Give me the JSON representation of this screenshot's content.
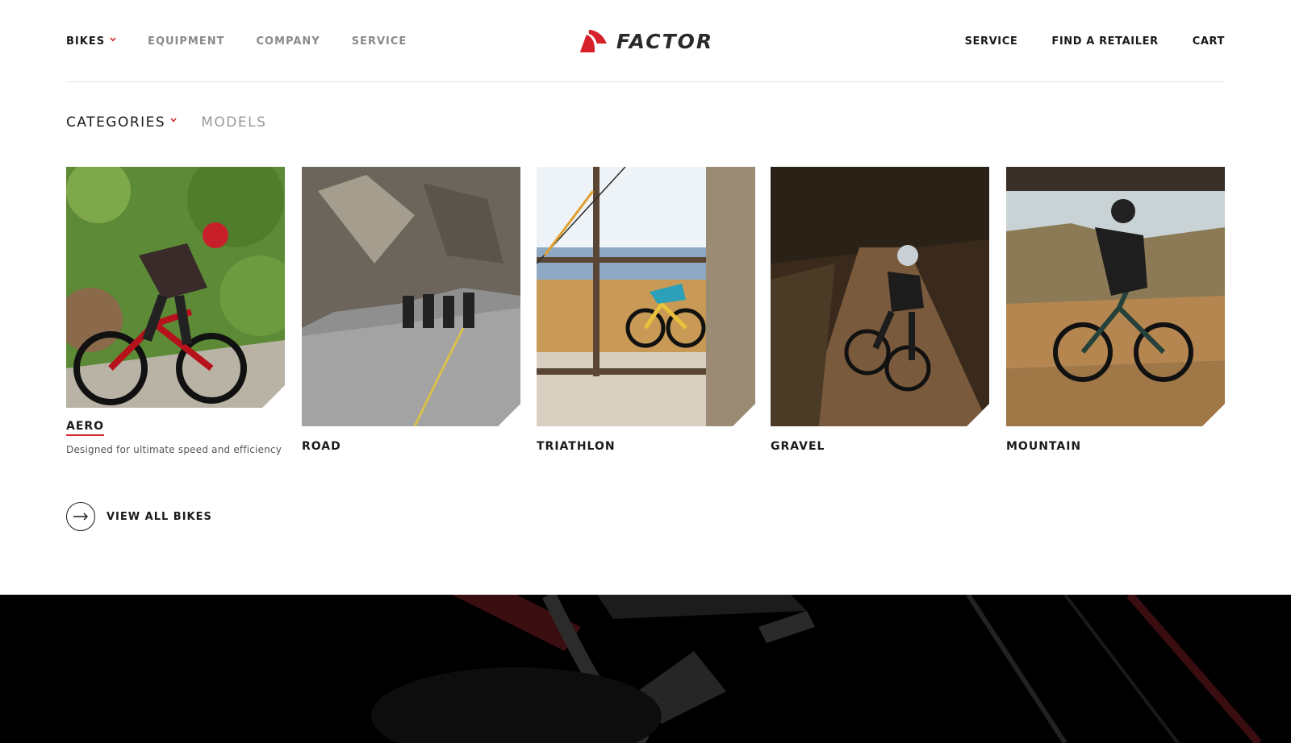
{
  "header": {
    "nav_left": [
      "BIKES",
      "EQUIPMENT",
      "COMPANY",
      "SERVICE"
    ],
    "logo_text": "FACTOR",
    "nav_right": [
      "SERVICE",
      "FIND A RETAILER",
      "CART"
    ]
  },
  "subnav": {
    "categories": "CATEGORIES",
    "models": "MODELS"
  },
  "cards": [
    {
      "label": "AERO",
      "desc": "Designed for ultimate speed  and efficiency"
    },
    {
      "label": "ROAD"
    },
    {
      "label": "TRIATHLON"
    },
    {
      "label": "GRAVEL"
    },
    {
      "label": "MOUNTAIN"
    }
  ],
  "view_all": {
    "label": "VIEW ALL BIKES",
    "icon": "arrow-right-icon"
  },
  "colors": {
    "accent": "#d6202a",
    "text": "#1a1a1a",
    "muted": "#8a8a8a"
  }
}
